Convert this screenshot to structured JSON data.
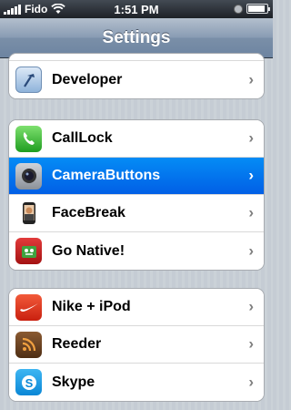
{
  "status_bar": {
    "carrier": "Fido",
    "time": "1:51 PM"
  },
  "nav": {
    "title": "Settings"
  },
  "groups": [
    {
      "items": [
        {
          "label": "Developer",
          "icon": "developer-hammer-icon"
        }
      ]
    },
    {
      "items": [
        {
          "label": "CallLock",
          "icon": "phone-icon"
        },
        {
          "label": "CameraButtons",
          "icon": "camera-lens-icon",
          "selected": true
        },
        {
          "label": "FaceBreak",
          "icon": "iphone-face-icon"
        },
        {
          "label": "Go Native!",
          "icon": "go-native-icon"
        }
      ]
    },
    {
      "items": [
        {
          "label": "Nike + iPod",
          "icon": "nike-swoosh-icon"
        },
        {
          "label": "Reeder",
          "icon": "rss-feed-icon"
        },
        {
          "label": "Skype",
          "icon": "skype-icon"
        }
      ]
    }
  ],
  "colors": {
    "selection": "#0a72ee",
    "nav_bar": "#7a8fa8",
    "background": "#c5ccd4"
  }
}
